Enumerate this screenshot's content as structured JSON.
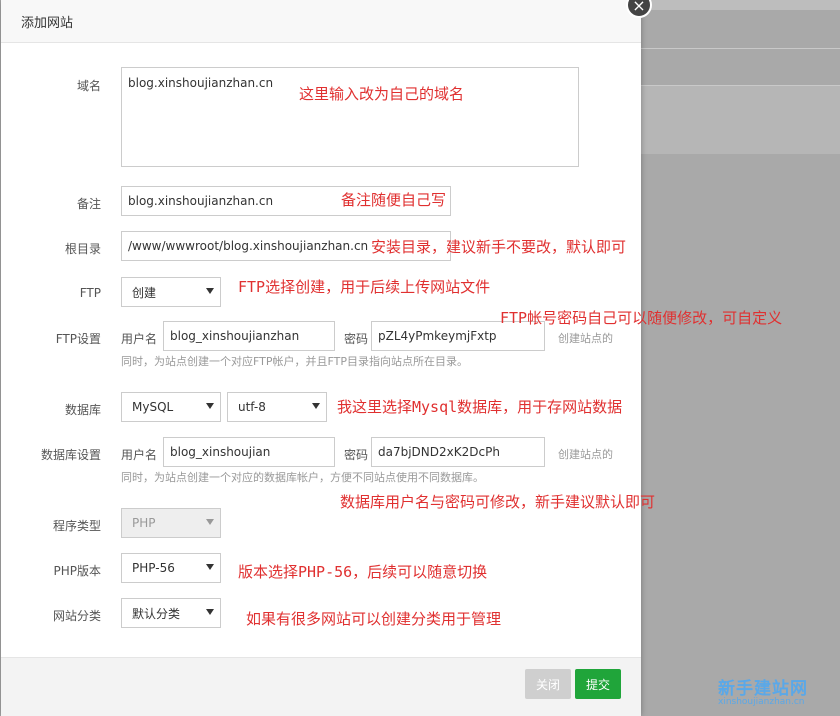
{
  "modal": {
    "title": "添加网站",
    "close_icon": "×"
  },
  "form": {
    "domain": {
      "label": "域名",
      "value": "blog.xinshoujianzhan.cn"
    },
    "remark": {
      "label": "备注",
      "value": "blog.xinshoujianzhan.cn"
    },
    "root": {
      "label": "根目录",
      "value": "/www/wwwroot/blog.xinshoujianzhan.cn"
    },
    "ftp": {
      "label": "FTP",
      "selected": "创建"
    },
    "ftp_settings": {
      "label": "FTP设置",
      "user_label": "用户名",
      "user_value": "blog_xinshoujianzhan",
      "pass_label": "密码",
      "pass_value": "pZL4yPmkeymjFxtp",
      "side_hint": "创建站点的",
      "hint": "同时，为站点创建一个对应FTP帐户，并且FTP目录指向站点所在目录。"
    },
    "database": {
      "label": "数据库",
      "selected": "MySQL",
      "charset": "utf-8"
    },
    "db_settings": {
      "label": "数据库设置",
      "user_label": "用户名",
      "user_value": "blog_xinshoujian",
      "pass_label": "密码",
      "pass_value": "da7bjDND2xK2DcPh",
      "side_hint": "创建站点的",
      "hint": "同时，为站点创建一个对应的数据库帐户，方便不同站点使用不同数据库。"
    },
    "program_type": {
      "label": "程序类型",
      "selected": "PHP"
    },
    "php_version": {
      "label": "PHP版本",
      "selected": "PHP-56"
    },
    "category": {
      "label": "网站分类",
      "selected": "默认分类"
    }
  },
  "annotations": {
    "domain": "这里输入改为自己的域名",
    "remark": "备注随便自己写",
    "root": "安装目录，建议新手不要改，默认即可",
    "ftp": "FTP选择创建，用于后续上传网站文件",
    "ftp_settings": "FTP帐号密码自己可以随便修改，可自定义",
    "database": "我这里选择Mysql数据库，用于存网站数据",
    "db_settings": "数据库用户名与密码可修改，新手建议默认即可",
    "php_version": "版本选择PHP-56，后续可以随意切换",
    "category": "如果有很多网站可以创建分类用于管理"
  },
  "footer": {
    "close_label": "关闭",
    "submit_label": "提交"
  },
  "watermark": {
    "title": "新手建站网",
    "url": "xinshoujianzhan.cn"
  },
  "colors": {
    "submit": "#20a53a",
    "annotation": "#e03030",
    "watermark": "#5aa8e8"
  }
}
